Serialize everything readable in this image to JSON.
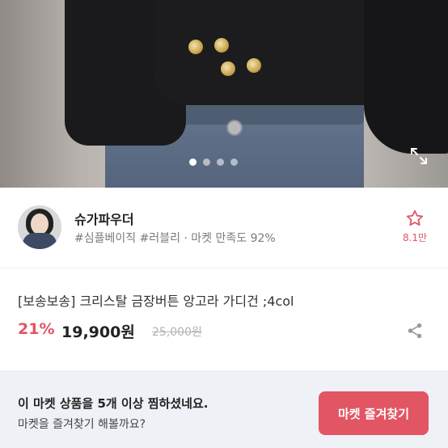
{
  "gallery": {
    "image_alt": "cropped black angora cardigan with gold buttons and jeans",
    "page_count": 4,
    "active_index": 0
  },
  "seller": {
    "name": "슈가파우더",
    "tags": "#심플베이직 #러블리 · 마켓 만족도 92%",
    "likes": "8.1만"
  },
  "product": {
    "title": "[보송보송] 크리스탈 금장버튼 앙고라 가디건 ;4col",
    "discount": "21%",
    "price": "19,900원",
    "original_price": "25,000원"
  },
  "banner": {
    "main_text": "이 마켓 상품을 5개 이상 찜하셨네요.",
    "sub_text": "마켓을 즐겨찾기 해볼까요?",
    "button_label": "마켓 즐겨찾기"
  },
  "colors": {
    "accent": "#e25563",
    "banner_bg": "#eef1f5"
  },
  "icons": [
    "expand-icon",
    "star-icon",
    "share-icon"
  ]
}
